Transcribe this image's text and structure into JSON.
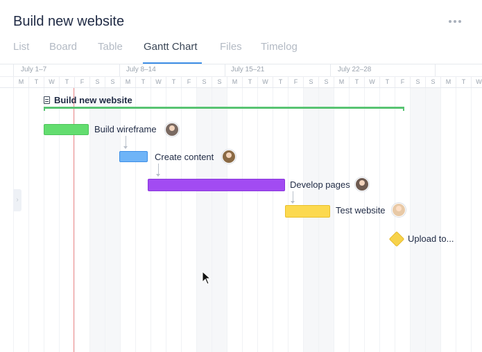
{
  "header": {
    "title": "Build new website",
    "more_icon": "more-dots-icon"
  },
  "tabs": [
    {
      "label": "List",
      "active": false
    },
    {
      "label": "Board",
      "active": false
    },
    {
      "label": "Table",
      "active": false
    },
    {
      "label": "Gantt Chart",
      "active": true
    },
    {
      "label": "Files",
      "active": false
    },
    {
      "label": "Timelog",
      "active": false
    }
  ],
  "timeline": {
    "weeks": [
      "July 1–7",
      "July 8–14",
      "July 15–21",
      "July 22–28"
    ],
    "day_letters": [
      "M",
      "T",
      "W",
      "T",
      "F",
      "S",
      "S",
      "M",
      "T",
      "W",
      "T",
      "F",
      "S",
      "S",
      "M",
      "T",
      "W",
      "T",
      "F",
      "S",
      "S",
      "M",
      "T",
      "W",
      "T",
      "F",
      "S",
      "S",
      "M",
      "T",
      "W"
    ]
  },
  "project": {
    "title": "Build new website",
    "icon": "document-icon"
  },
  "tasks": [
    {
      "label": "Build wireframe",
      "color": "#63dd6f",
      "border": "#4cc45a"
    },
    {
      "label": "Create content",
      "color": "#6fb4f7",
      "border": "#3d8ee6"
    },
    {
      "label": "Develop pages",
      "color": "#a24bf2",
      "border": "#8a35dc"
    },
    {
      "label": "Test website",
      "color": "#fcd94f",
      "border": "#e9bf2a"
    }
  ],
  "milestone": {
    "label": "Upload to...",
    "color": "#f7d24a"
  },
  "colors": {
    "accent": "#3d8ee6",
    "today_line": "#f08a8a",
    "project_bar": "#58c472"
  }
}
